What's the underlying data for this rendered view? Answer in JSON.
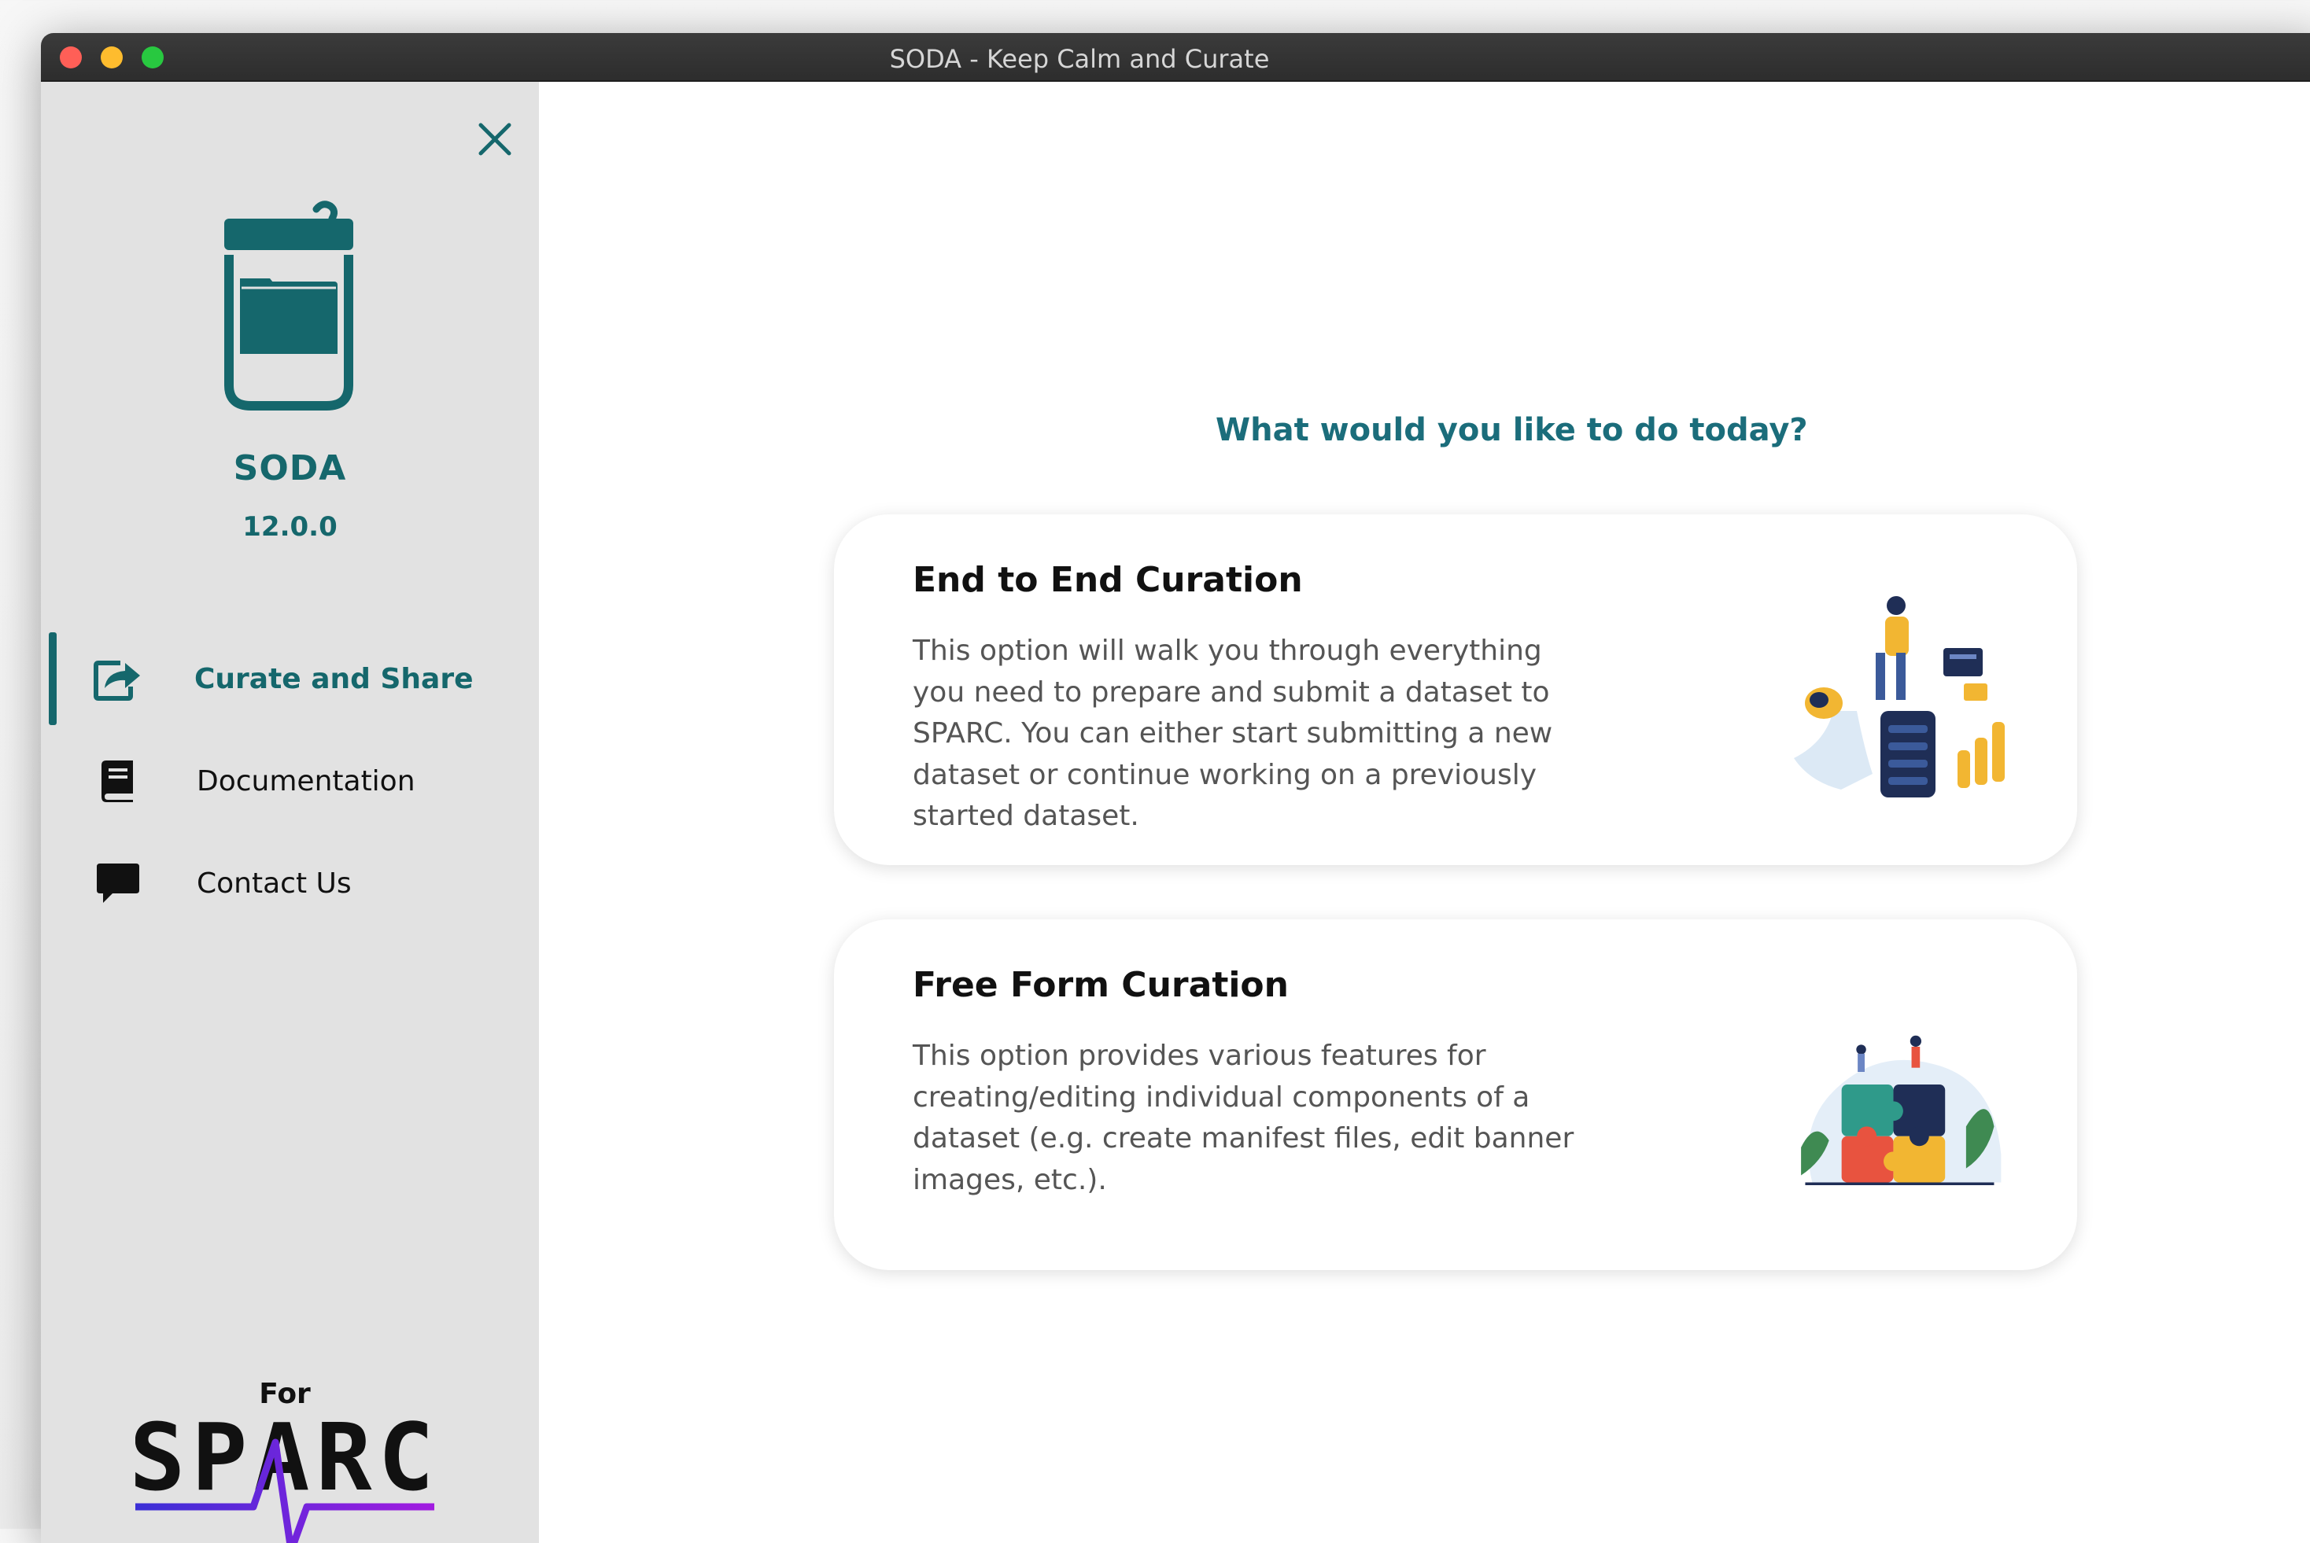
{
  "window": {
    "title": "SODA - Keep Calm and Curate"
  },
  "sidebar": {
    "app_name": "SODA",
    "version": "12.0.0",
    "items": [
      {
        "label": "Curate and Share",
        "icon": "share-icon",
        "active": true
      },
      {
        "label": "Documentation",
        "icon": "book-icon",
        "active": false
      },
      {
        "label": "Contact Us",
        "icon": "chat-icon",
        "active": false
      }
    ],
    "footer": {
      "prefix": "For",
      "logo_text": "SPARC"
    }
  },
  "main": {
    "question": "What would you like to do today?",
    "cards": [
      {
        "title": "End to End Curation",
        "description": "This option will walk you through everything you need to prepare and submit a dataset to SPARC. You can either start submitting a new dataset or continue working on a previously started dataset.",
        "illustration": "server-people-illustration"
      },
      {
        "title": "Free Form Curation",
        "description": "This option provides various features for creating/editing individual components of a dataset (e.g. create manifest files, edit banner images, etc.).",
        "illustration": "puzzle-people-illustration"
      }
    ]
  },
  "colors": {
    "accent": "#15676c",
    "question": "#1b6d7b",
    "sidebar_bg": "#e2e2e2",
    "sparc_gradient_start": "#3a2fd6",
    "sparc_gradient_end": "#a21be0"
  }
}
